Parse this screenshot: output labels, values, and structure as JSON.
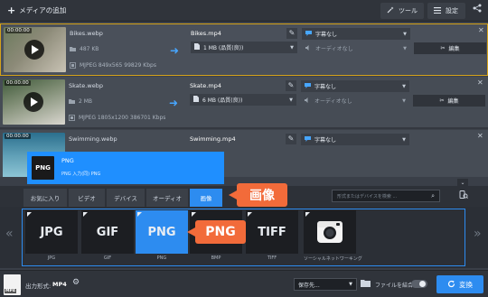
{
  "topbar": {
    "add_media_label": "メディアの追加",
    "tools_label": "ツール",
    "settings_label": "設定"
  },
  "files": [
    {
      "time": "00:00:00",
      "source_name": "Bikes.webp",
      "source_size": "487 KB",
      "source_info": "MJPEG 849x565 99829 Kbps",
      "output_name": "Bikes.mp4",
      "output_size": "1 MB (品質(良))",
      "subtitles": "字幕なし",
      "audio": "オーディオなし",
      "edit_label": "編集",
      "thumb_colors": [
        "#6b7a5c",
        "#c9c3b5"
      ]
    },
    {
      "time": "00:00:00",
      "source_name": "Skate.webp",
      "source_size": "2 MB",
      "source_info": "MJPEG 1805x1200 386701 Kbps",
      "output_name": "Skate.mp4",
      "output_size": "6 MB (品質(良))",
      "subtitles": "字幕なし",
      "audio": "オーディオなし",
      "edit_label": "編集",
      "thumb_colors": [
        "#3f5a3a",
        "#d9d6cf"
      ]
    },
    {
      "time": "00:00:00",
      "source_name": "Swimming.webp",
      "source_size": "",
      "source_info": "",
      "output_name": "Swimming.mp4",
      "output_size": "",
      "subtitles": "字幕なし",
      "audio": "",
      "edit_label": "",
      "thumb_colors": [
        "#2b6f8e",
        "#8fc6d6"
      ]
    }
  ],
  "popup": {
    "icon_text": "PNG",
    "title": "PNG",
    "subtitle": "PNG 入力(同) PNG"
  },
  "tabs": [
    {
      "label": "お気に入り"
    },
    {
      "label": "ビデオ"
    },
    {
      "label": "デバイス"
    },
    {
      "label": "オーディオ"
    },
    {
      "label": "画像"
    }
  ],
  "search": {
    "placeholder": "形式またはデバイスを検索 ..."
  },
  "callouts": {
    "tab": "画像",
    "format": "PNG"
  },
  "formats": [
    {
      "tile": "JPG",
      "label": "JPG"
    },
    {
      "tile": "GIF",
      "label": "GIF"
    },
    {
      "tile": "PNG",
      "label": "PNG"
    },
    {
      "tile": "BMP",
      "label": "BMP"
    },
    {
      "tile": "TIFF",
      "label": "TIFF"
    },
    {
      "tile": "",
      "label": "ソーシャルネットワーキング"
    }
  ],
  "bottom": {
    "output_format_label": "出力形式:",
    "output_format_value": "MP4",
    "save_to_label": "保存先...",
    "merge_label": "ファイルを結合:",
    "convert_label": "変換"
  },
  "colors": {
    "accent": "#2d8cf0",
    "callout": "#f26b3a",
    "selected_border": "#d4a21a"
  }
}
